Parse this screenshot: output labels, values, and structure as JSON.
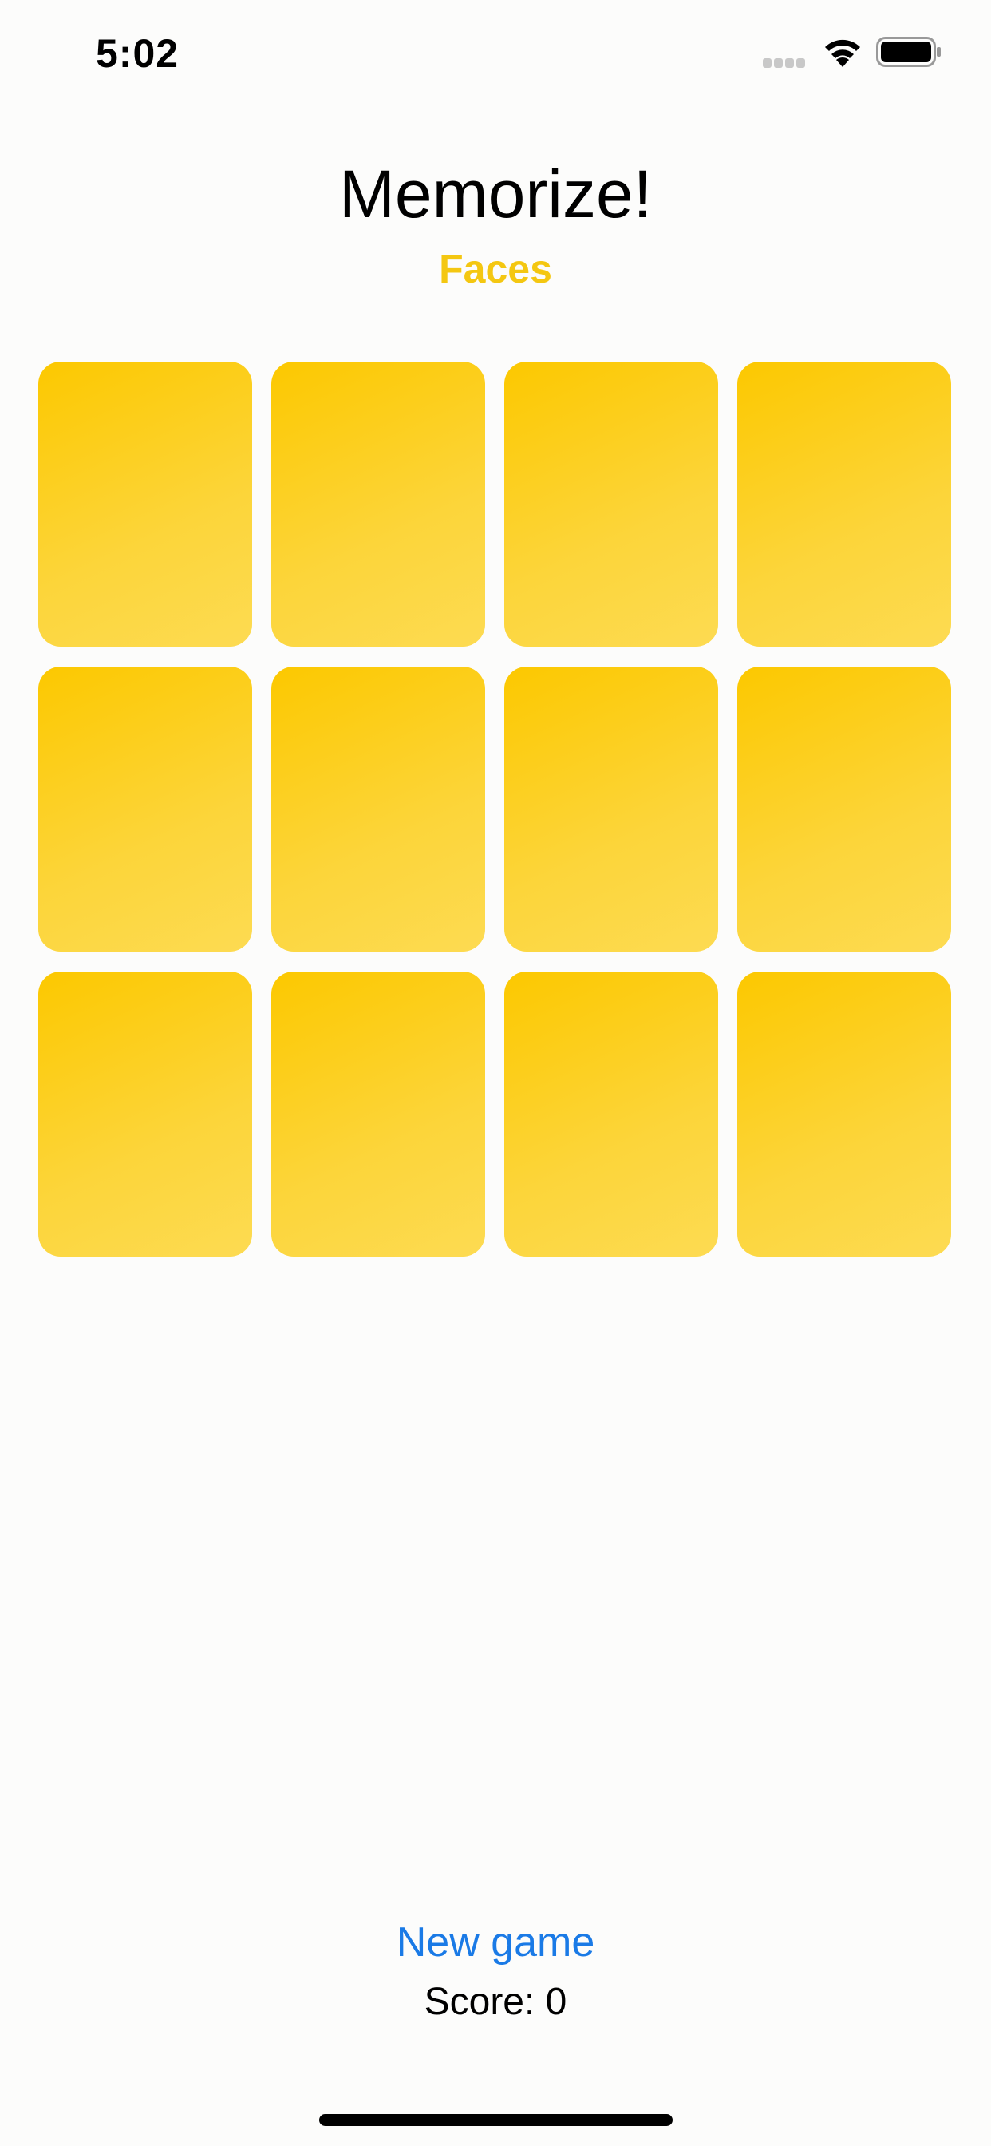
{
  "status_bar": {
    "time": "5:02",
    "icons": [
      "signal-icon",
      "wifi-icon",
      "battery-icon"
    ]
  },
  "header": {
    "title": "Memorize!",
    "theme": "Faces",
    "theme_color": "#f4c711"
  },
  "cards": [
    {
      "face_up": false
    },
    {
      "face_up": false
    },
    {
      "face_up": false
    },
    {
      "face_up": false
    },
    {
      "face_up": false
    },
    {
      "face_up": false
    },
    {
      "face_up": false
    },
    {
      "face_up": false
    },
    {
      "face_up": false
    },
    {
      "face_up": false
    },
    {
      "face_up": false
    },
    {
      "face_up": false
    }
  ],
  "card_color": "#fcc800",
  "footer": {
    "new_game_label": "New game",
    "score_label": "Score: 0"
  },
  "accent_color": "#1a7ae6"
}
